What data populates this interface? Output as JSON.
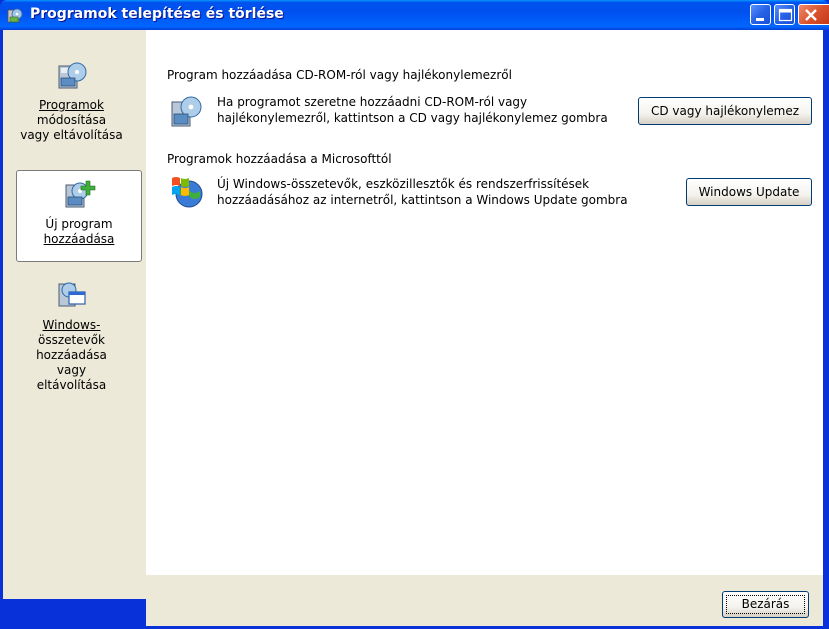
{
  "window": {
    "title": "Programok telepítése és törlése"
  },
  "titlebar_buttons": {
    "minimize_icon": "minimize-icon",
    "maximize_icon": "maximize-icon",
    "close_icon": "close-icon"
  },
  "sidebar": {
    "items": [
      {
        "label_lines": [
          "Programok",
          "módosítása",
          "vagy eltávolítása"
        ],
        "icon": "change-remove-programs-icon",
        "selected": false
      },
      {
        "label_lines": [
          "Új program",
          "hozzáadása"
        ],
        "icon": "add-new-program-icon",
        "selected": true
      },
      {
        "label_lines": [
          "Windows-",
          "összetevők",
          "hozzáadása",
          "vagy",
          "eltávolítása"
        ],
        "icon": "windows-components-icon",
        "selected": false
      }
    ]
  },
  "main": {
    "section1": {
      "heading": "Program hozzáadása CD-ROM-ról vagy hajlékonylemezről",
      "desc_line1": "Ha programot szeretne hozzáadni CD-ROM-ról vagy",
      "desc_line2": "hajlékonylemezről, kattintson a CD vagy hajlékonylemez gombra",
      "button": "CD vagy hajlékonylemez",
      "icon": "cd-install-icon"
    },
    "section2": {
      "heading": "Programok hozzáadása a Microsofttól",
      "desc_line1": "Új Windows-összetevők, eszközillesztők és rendszerfrissítések",
      "desc_line2": "hozzáadásához az internetről, kattintson a Windows Update gombra",
      "button": "Windows Update",
      "icon": "windows-update-icon"
    }
  },
  "footer": {
    "close_button": "Bezárás"
  },
  "colors": {
    "titlebar": "#0053ee",
    "sidebar_bg": "#ece9d8",
    "content_bg": "#ffffff",
    "frame": "#0831d9"
  }
}
